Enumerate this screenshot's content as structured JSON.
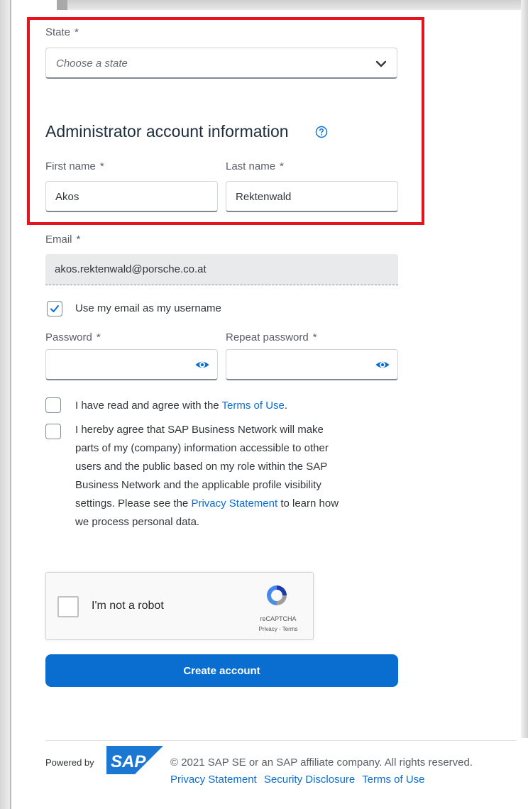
{
  "state": {
    "label": "State",
    "required_mark": "*",
    "placeholder": "Choose a state"
  },
  "admin": {
    "title": "Administrator account information",
    "first_name": {
      "label": "First name",
      "required_mark": "*",
      "value": "Akos"
    },
    "last_name": {
      "label": "Last name",
      "required_mark": "*",
      "value": "Rektenwald"
    },
    "email": {
      "label": "Email",
      "required_mark": "*",
      "value": "akos.rektenwald@porsche.co.at"
    },
    "use_email_username": {
      "label": "Use my email as my username",
      "checked": true
    },
    "password": {
      "label": "Password",
      "required_mark": "*",
      "value": ""
    },
    "repeat_password": {
      "label": "Repeat password",
      "required_mark": "*",
      "value": ""
    }
  },
  "agreements": {
    "terms": {
      "prefix": "I have read and agree with the ",
      "link": "Terms of Use",
      "suffix": ".",
      "checked": false
    },
    "privacy": {
      "line1": "I hereby agree that SAP Business Network will make",
      "line2": "parts of my (company) information accessible to other",
      "line3": "users and the public based on my role within the SAP",
      "line4": "Business Network and the applicable profile visibility",
      "line5_prefix": "settings. Please see the ",
      "line5_link": "Privacy Statement",
      "line5_suffix": " to learn how",
      "line6": "we process personal data.",
      "checked": false
    }
  },
  "recaptcha": {
    "label": "I'm not a robot",
    "brand": "reCAPTCHA",
    "terms": "Privacy - Terms"
  },
  "actions": {
    "create_account": "Create account"
  },
  "footer": {
    "powered_by": "Powered by",
    "logo_text": "SAP",
    "copyright": "© 2021 SAP SE or an SAP affiliate company. All rights reserved.",
    "links": [
      "Privacy Statement",
      "Security Disclosure",
      "Terms of Use"
    ]
  },
  "colors": {
    "accent": "#0a6ed1",
    "highlight_border": "#e6141e",
    "sap_blue": "#1b77d2"
  }
}
